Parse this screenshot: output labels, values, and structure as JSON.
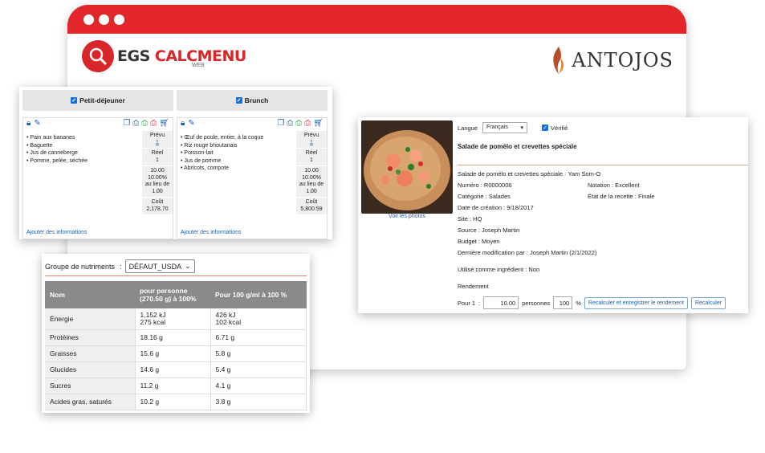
{
  "app": {
    "logo_text_a": "EGS ",
    "logo_text_b": "CALCMENU",
    "logo_sub": "WEB",
    "brand": "ANTOJOS",
    "accent": "#e3262c"
  },
  "menu": {
    "columns": [
      {
        "header": "Petit-déjeuner",
        "items": [
          "Pain aux bananes",
          "Baguette",
          "Jus de canneberge",
          "Pomme, pelée, séchée"
        ],
        "prevu_label": "Prévu",
        "prevu_value": "1",
        "reel_label": "Réel",
        "reel_value": "1",
        "ratio_a": "10.00",
        "ratio_b": "10.00%",
        "ratio_c": "au lieu de",
        "ratio_d": "1.00",
        "cout_label": "Coût",
        "cout_value": "2,178.70",
        "add_info": "Ajouter des informations"
      },
      {
        "header": "Brunch",
        "items": [
          "Œuf de poule, entier, à la coque",
          "Riz rouge bhoutanais",
          "Poisson-lait",
          "Jus de pomme",
          "Abricots, compote"
        ],
        "prevu_label": "Prévu",
        "prevu_value": "1",
        "reel_label": "Réel",
        "reel_value": "1",
        "ratio_a": "10.00",
        "ratio_b": "10.00%",
        "ratio_c": "au lieu de",
        "ratio_d": "1.00",
        "cout_label": "Coût",
        "cout_value": "5,800.59",
        "add_info": "Ajouter des informations"
      }
    ]
  },
  "nutrients": {
    "group_label": "Groupe de nutriments",
    "colon": ":",
    "group_value": "DÉFAUT_USDA",
    "headers": [
      "Nom",
      "pour personne (270.50 g) à 100%",
      "Pour 100 g/ml à 100 %"
    ],
    "rows": [
      {
        "name": "Énergie",
        "per_person": [
          "1,152 kJ",
          "275 kcal"
        ],
        "per_100": [
          "426 kJ",
          "102 kcal"
        ]
      },
      {
        "name": "Protéines",
        "per_person": [
          "18.16 g"
        ],
        "per_100": [
          "6.71 g"
        ]
      },
      {
        "name": "Graisses",
        "per_person": [
          "15.6 g"
        ],
        "per_100": [
          "5.8 g"
        ]
      },
      {
        "name": "Glucides",
        "per_person": [
          "14.6 g"
        ],
        "per_100": [
          "5.4 g"
        ]
      },
      {
        "name": "Sucres",
        "per_person": [
          "11.2 g"
        ],
        "per_100": [
          "4.1 g"
        ]
      },
      {
        "name": "Acides gras, saturés",
        "per_person": [
          "10.2 g"
        ],
        "per_100": [
          "3.8 g"
        ]
      }
    ]
  },
  "recipe": {
    "photo_link": "Voir les photos",
    "lang_label": "Langue",
    "lang_value": "Français",
    "verified_label": "Vérifié",
    "title": "Salade de pomélo et crevettes spéciale",
    "subtitle": "Salade de pomélo et crevettes spéciale · Yam Som-O",
    "numero": "Numéro : R0000006",
    "notation": "Notation : Excellent",
    "categorie": "Catégorie : Salades",
    "etat": "État de la recette : Finale",
    "date": "Date de création : 9/18/2017",
    "site": "Site : HQ",
    "source": "Source : Joseph Martin",
    "budget": "Budget : Moyen",
    "modif": "Dernière modification par : Joseph Martin (2/1/2022)",
    "ingredient": "Utilisé comme ingrédient : Non",
    "rendement": "Rendement",
    "pour_label": "Pour 1",
    "pour_colon": ":",
    "persons_value": "10.00",
    "persons_label": "personnes",
    "pct_value": "100",
    "pct_sign": "%",
    "btn_save": "Recalculer et enregistrer le rendement",
    "btn_recalc": "Recalculer"
  }
}
